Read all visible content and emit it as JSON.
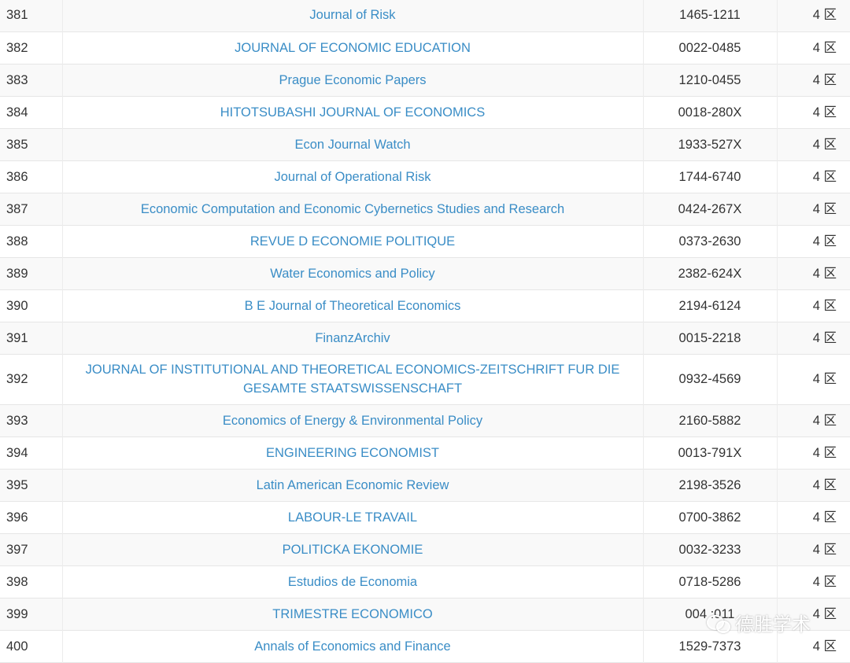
{
  "rows": [
    {
      "index": "381",
      "title": "Journal of Risk",
      "issn": "1465-1211",
      "zone": "4 区"
    },
    {
      "index": "382",
      "title": "JOURNAL OF ECONOMIC EDUCATION",
      "issn": "0022-0485",
      "zone": "4 区"
    },
    {
      "index": "383",
      "title": "Prague Economic Papers",
      "issn": "1210-0455",
      "zone": "4 区"
    },
    {
      "index": "384",
      "title": "HITOTSUBASHI JOURNAL OF ECONOMICS",
      "issn": "0018-280X",
      "zone": "4 区"
    },
    {
      "index": "385",
      "title": "Econ Journal Watch",
      "issn": "1933-527X",
      "zone": "4 区"
    },
    {
      "index": "386",
      "title": "Journal of Operational Risk",
      "issn": "1744-6740",
      "zone": "4 区"
    },
    {
      "index": "387",
      "title": "Economic Computation and Economic Cybernetics Studies and Research",
      "issn": "0424-267X",
      "zone": "4 区"
    },
    {
      "index": "388",
      "title": "REVUE D ECONOMIE POLITIQUE",
      "issn": "0373-2630",
      "zone": "4 区"
    },
    {
      "index": "389",
      "title": "Water Economics and Policy",
      "issn": "2382-624X",
      "zone": "4 区"
    },
    {
      "index": "390",
      "title": "B E Journal of Theoretical Economics",
      "issn": "2194-6124",
      "zone": "4 区"
    },
    {
      "index": "391",
      "title": "FinanzArchiv",
      "issn": "0015-2218",
      "zone": "4 区"
    },
    {
      "index": "392",
      "title": "JOURNAL OF INSTITUTIONAL AND THEORETICAL ECONOMICS-ZEITSCHRIFT FUR DIE GESAMTE STAATSWISSENSCHAFT",
      "issn": "0932-4569",
      "zone": "4 区"
    },
    {
      "index": "393",
      "title": "Economics of Energy & Environmental Policy",
      "issn": "2160-5882",
      "zone": "4 区"
    },
    {
      "index": "394",
      "title": "ENGINEERING ECONOMIST",
      "issn": "0013-791X",
      "zone": "4 区"
    },
    {
      "index": "395",
      "title": "Latin American Economic Review",
      "issn": "2198-3526",
      "zone": "4 区"
    },
    {
      "index": "396",
      "title": "LABOUR-LE TRAVAIL",
      "issn": "0700-3862",
      "zone": "4 区"
    },
    {
      "index": "397",
      "title": "POLITICKA EKONOMIE",
      "issn": "0032-3233",
      "zone": "4 区"
    },
    {
      "index": "398",
      "title": "Estudios de Economia",
      "issn": "0718-5286",
      "zone": "4 区"
    },
    {
      "index": "399",
      "title": "TRIMESTRE ECONOMICO",
      "issn": "004 :011",
      "zone": "4 区"
    },
    {
      "index": "400",
      "title": "Annals of Economics and Finance",
      "issn": "1529-7373",
      "zone": "4 区"
    }
  ],
  "watermark": {
    "text": "德胜学术",
    "icon": "wechat-icon"
  },
  "colors": {
    "link": "#3a8dc6",
    "text": "#333333",
    "stripe": "#f9f9f9",
    "border": "#e6e6e6"
  }
}
